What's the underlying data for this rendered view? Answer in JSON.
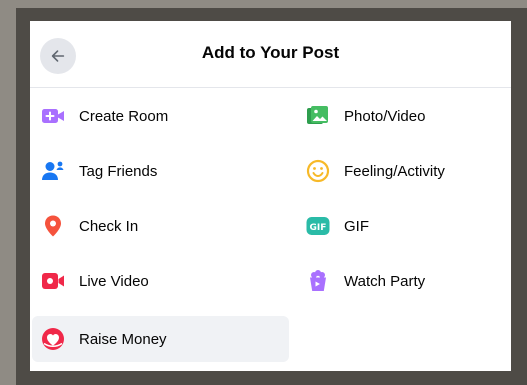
{
  "dialog": {
    "title": "Add to Your Post"
  },
  "items": {
    "create_room": {
      "label": "Create Room",
      "icon": "video-plus-icon",
      "color": "#a970ff"
    },
    "photo_video": {
      "label": "Photo/Video",
      "icon": "photo-icon",
      "color": "#45bd62"
    },
    "tag_friends": {
      "label": "Tag Friends",
      "icon": "tag-people-icon",
      "color": "#1877f2"
    },
    "feeling_activity": {
      "label": "Feeling/Activity",
      "icon": "smiley-icon",
      "color": "#f7b928"
    },
    "check_in": {
      "label": "Check In",
      "icon": "location-pin-icon",
      "color": "#f5533d"
    },
    "gif": {
      "label": "GIF",
      "icon": "gif-icon",
      "color": "#2abba7",
      "badge_text": "GIF"
    },
    "live_video": {
      "label": "Live Video",
      "icon": "live-video-icon",
      "color": "#f02849"
    },
    "watch_party": {
      "label": "Watch Party",
      "icon": "popcorn-icon",
      "color": "#a970ff"
    },
    "raise_money": {
      "label": "Raise Money",
      "icon": "fundraiser-heart-icon",
      "color": "#f02849"
    }
  }
}
